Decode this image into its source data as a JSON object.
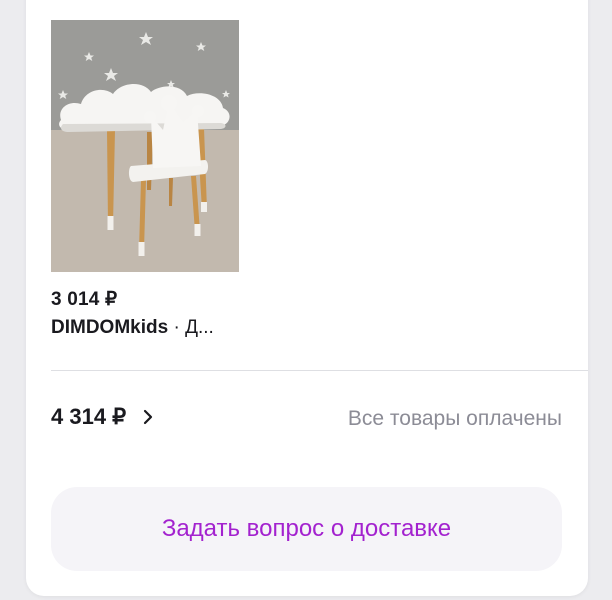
{
  "order_item": {
    "image_alt": "Children's cloud table with crown chair",
    "price": "3 014 ₽",
    "seller_brand": "DIMDOMkids",
    "seller_rest": " · Д..."
  },
  "summary": {
    "total": "4 314 ₽",
    "chevron_icon": "chevron-right-icon",
    "status": "Все товары оплачены"
  },
  "actions": {
    "ask_delivery": "Задать вопрос о доставке"
  },
  "colors": {
    "accent": "#a322cf",
    "muted_text": "#8c8c96",
    "button_bg": "#f5f4f8"
  }
}
